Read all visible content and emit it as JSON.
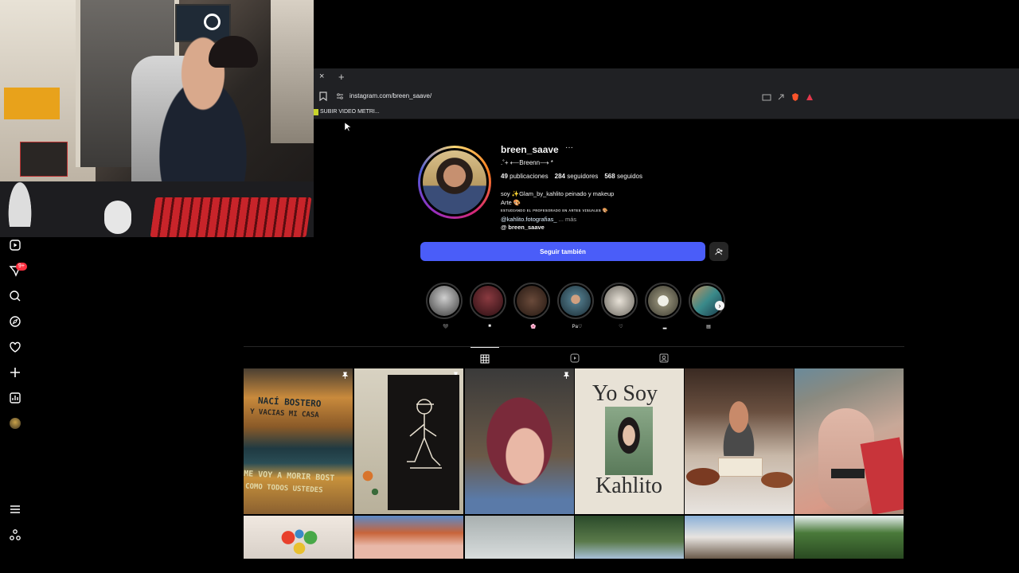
{
  "browser": {
    "tab_close": "×",
    "tab_new": "+",
    "url": "instagram.com/breen_saave/",
    "bookmark_label": "SUBIR VIDEO METRI..."
  },
  "profile": {
    "username": "breen_saave",
    "more": "···",
    "fullname": ".˚+ ⟵Breenn⟶ *",
    "posts_count": "49",
    "posts_label": "publicaciones",
    "followers_count": "284",
    "followers_label": "seguidores",
    "following_count": "568",
    "following_label": "seguidos",
    "bio_line1": "soy ✨Glam_by_kahlito peinado y makeup",
    "bio_line2": "Arte 🎨",
    "bio_line3": "ᴇꜱᴛᴜᴅɪᴀɴᴅᴏ ᴇʟ ᴘʀᴏꜰᴇꜱᴏʀᴀᴅᴏ ᴇɴ ᴀʀᴛᴇꜱ ᴠɪꜱᴜᴀʟᴇꜱ 🎨",
    "bio_link": "@kahlito.fotografias_",
    "bio_more": "... más",
    "threads_handle": "breen_saave",
    "follow_button": "Seguir también"
  },
  "highlights": [
    {
      "label": "🖤",
      "color": "#8a8a8a"
    },
    {
      "label": "■",
      "color": "#6a2228"
    },
    {
      "label": "🌸",
      "color": "#4a3028"
    },
    {
      "label": "Pa♡",
      "color": "#5a7a88"
    },
    {
      "label": "♡",
      "color": "#b8b2a8"
    },
    {
      "label": "▂",
      "color": "#8a8670"
    },
    {
      "label": "▤",
      "color": "#6f8a7a"
    }
  ],
  "grid": {
    "tile1_text_top": "NACÍ BOSTERO",
    "tile1_text_mid": "Y VACIAS MI CASA",
    "tile1_text_bot": "ME VOY A MORIR BOST",
    "tile1_text_bot2": "COMO TODOS USTEDES",
    "tile4_text_top": "Yo Soy",
    "tile4_text_bot": "Kahlito"
  },
  "colors": {
    "follow_blue": "#4a5df9",
    "story_ring": "#d62976"
  }
}
